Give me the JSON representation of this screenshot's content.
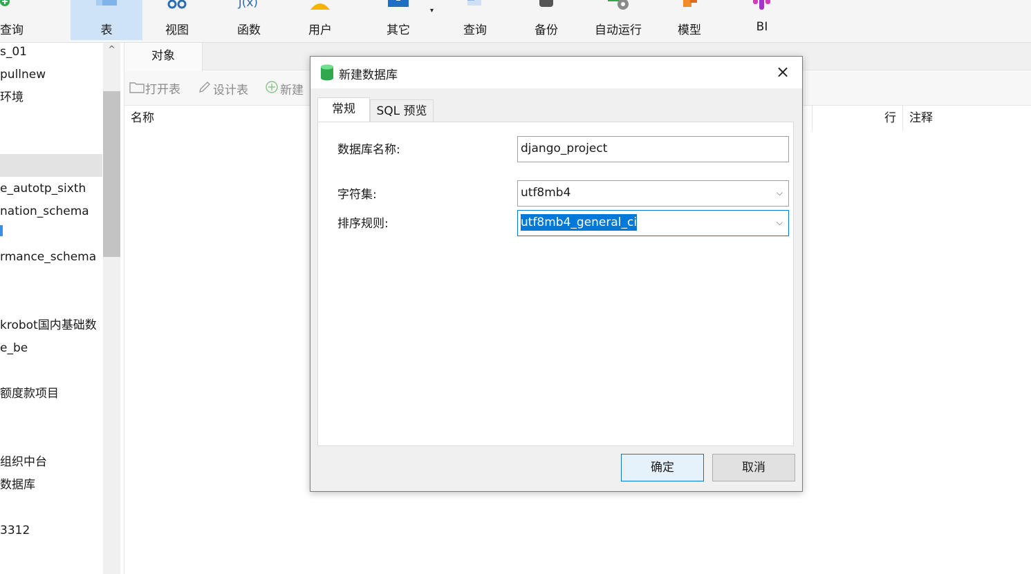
{
  "toolbar": {
    "items": [
      {
        "label": "查询",
        "icon": "query-add-icon"
      },
      {
        "label": "表",
        "icon": "table-icon",
        "active": true
      },
      {
        "label": "视图",
        "icon": "view-icon"
      },
      {
        "label": "函数",
        "icon": "function-icon"
      },
      {
        "label": "用户",
        "icon": "user-icon"
      },
      {
        "label": "其它",
        "icon": "toolbox-icon"
      },
      {
        "label": "查询",
        "icon": "query-icon"
      },
      {
        "label": "备份",
        "icon": "backup-icon"
      },
      {
        "label": "自动运行",
        "icon": "automation-icon"
      },
      {
        "label": "模型",
        "icon": "model-icon"
      },
      {
        "label": "BI",
        "icon": "bi-icon"
      }
    ],
    "caret": "▾"
  },
  "sidebar": {
    "items": [
      "s_01",
      "pullnew",
      "环境",
      "",
      "",
      "e_autotp_sixth",
      "nation_schema",
      "",
      "rmance_schema",
      "",
      "",
      "krobot国内基础数",
      "e_be",
      "",
      "额度款项目",
      "",
      "",
      "组织中台",
      "数据库",
      "",
      "3312"
    ],
    "scroll_up": "^"
  },
  "main": {
    "tab_objects": "对象",
    "buttons": {
      "open_table": "打开表",
      "design_table": "设计表",
      "new_table": "新建"
    },
    "columns": {
      "name": "名称",
      "rows": "行",
      "comment": "注释"
    }
  },
  "dialog": {
    "title": "新建数据库",
    "close": "×",
    "tabs": {
      "general": "常规",
      "sql_preview": "SQL 预览"
    },
    "fields": {
      "db_name_label": "数据库名称:",
      "db_name_value": "django_project",
      "charset_label": "字符集:",
      "charset_value": "utf8mb4",
      "collation_label": "排序规则:",
      "collation_value": "utf8mb4_general_ci"
    },
    "buttons": {
      "ok": "确定",
      "cancel": "取消"
    }
  },
  "colors": {
    "accent": "#0078d7",
    "active_tab": "#cfe3f7",
    "db_icon": "#2fa84f"
  }
}
